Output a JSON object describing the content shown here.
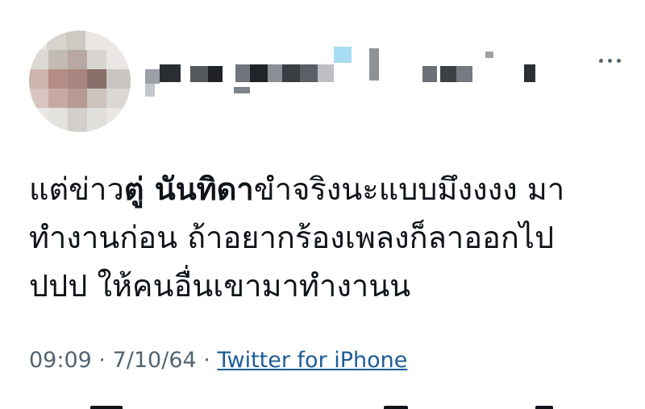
{
  "tweet": {
    "text_before": "แต่ข่าว",
    "mention_bold": "ตู่ นันทิดา",
    "text_after": "ขำจริงนะแบบมึงงงง มา\nทำงานก่อน ถ้าอยากร้องเพลงก็ลาออกไป\nปปป ให้คนอื่นเขามาทำงานน",
    "time": "09:09",
    "separator_1": "·",
    "date": "7/10/64",
    "separator_2": "·",
    "source": "Twitter for iPhone"
  },
  "header": {
    "avatar_icon": "blurred-avatar",
    "name": "",
    "more_icon": "more-horizontal-icon"
  },
  "colors": {
    "text": "#0f1419",
    "meta": "#536471",
    "link": "#1d5c94"
  }
}
